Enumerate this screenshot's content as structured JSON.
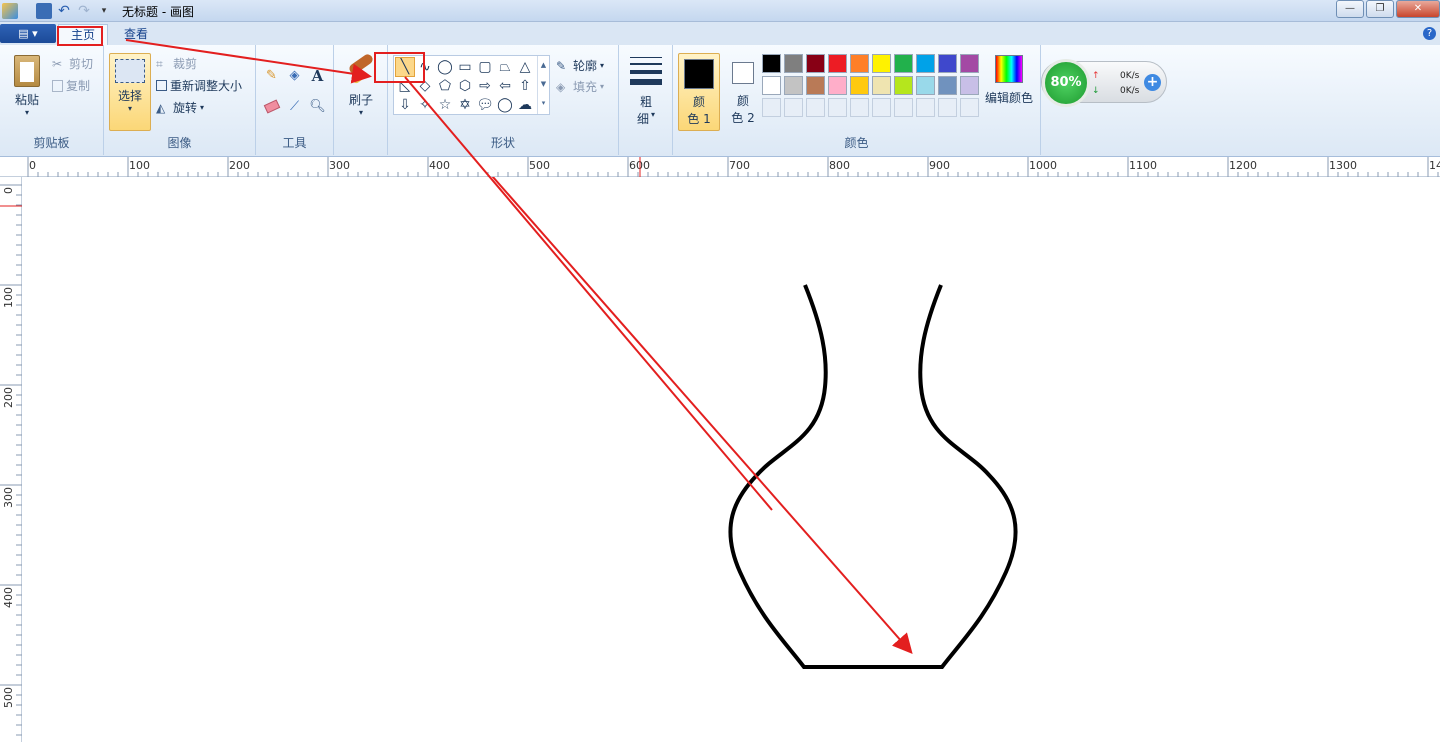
{
  "window": {
    "title": "无标题 - 画图"
  },
  "tabs": {
    "home": "主页",
    "view": "查看"
  },
  "ribbon": {
    "clipboard": {
      "paste": "粘贴",
      "cut": "剪切",
      "copy": "复制",
      "label": "剪贴板"
    },
    "image": {
      "select": "选择",
      "crop": "裁剪",
      "resize": "重新调整大小",
      "rotate": "旋转",
      "label": "图像"
    },
    "tools": {
      "label": "工具",
      "text_glyph": "A"
    },
    "brushes": {
      "label": "刷子"
    },
    "shapes": {
      "outline": "轮廓",
      "fill": "填充",
      "label": "形状"
    },
    "size": {
      "line1": "粗",
      "line2": "细"
    },
    "colors": {
      "color1_line1": "颜",
      "color1_line2": "色 1",
      "color2_line1": "颜",
      "color2_line2": "色 2",
      "edit": "编辑颜色",
      "label": "颜色",
      "color1_value": "#000000",
      "color2_value": "#ffffff",
      "palette_row1": [
        "#000000",
        "#7f7f7f",
        "#880015",
        "#ed1c24",
        "#ff7f27",
        "#fff200",
        "#22b14c",
        "#00a2e8",
        "#3f48cc",
        "#a349a4"
      ],
      "palette_row2": [
        "#ffffff",
        "#c3c3c3",
        "#b97a57",
        "#ffaec9",
        "#ffc90e",
        "#efe4b0",
        "#b5e61d",
        "#99d9ea",
        "#7092be",
        "#c8bfe7"
      ]
    }
  },
  "net_widget": {
    "percent": "80%",
    "upload": "0K/s",
    "download": "0K/s"
  },
  "rulers": {
    "h_labels": [
      "0",
      "100",
      "200",
      "300",
      "400",
      "500",
      "600",
      "700",
      "800",
      "900",
      "1000",
      "1100",
      "1200",
      "1300",
      "14"
    ],
    "v_labels": [
      "0",
      "100",
      "200",
      "300",
      "400",
      "500"
    ]
  }
}
